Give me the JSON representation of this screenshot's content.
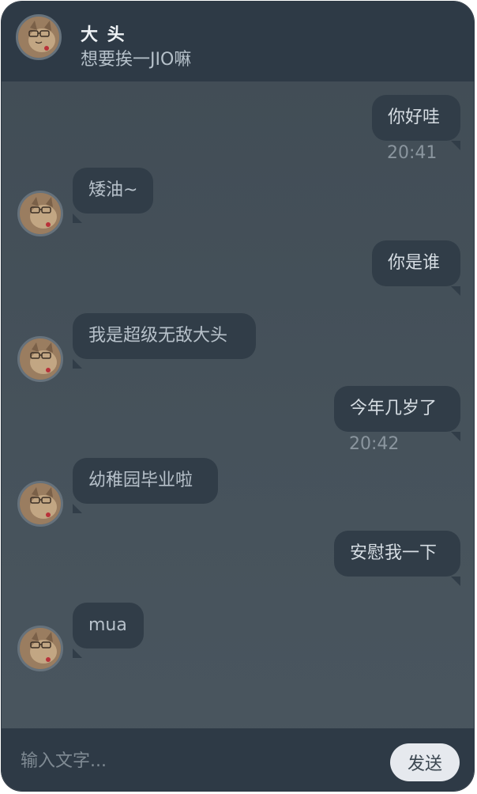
{
  "header": {
    "name": "大 头",
    "status": "想要挨一JIO嘛",
    "avatar_icon": "cat-avatar-icon"
  },
  "messages": [
    {
      "side": "right",
      "text": "你好哇",
      "time": "20:41"
    },
    {
      "side": "left",
      "text": "矮油~"
    },
    {
      "side": "right",
      "text": "你是谁"
    },
    {
      "side": "left",
      "text": "我是超级无敌大头"
    },
    {
      "side": "right",
      "text": "今年几岁了",
      "time": "20:42"
    },
    {
      "side": "left",
      "text": "幼稚园毕业啦"
    },
    {
      "side": "right",
      "text": "安慰我一下"
    },
    {
      "side": "left",
      "text": "mua"
    }
  ],
  "footer": {
    "input_placeholder": "输入文字...",
    "send_label": "发送"
  },
  "colors": {
    "header_bg": "#2e3a46",
    "chat_bg": "#434f58",
    "bubble_bg": "#313d48",
    "send_button_bg": "#e6e9ee"
  }
}
